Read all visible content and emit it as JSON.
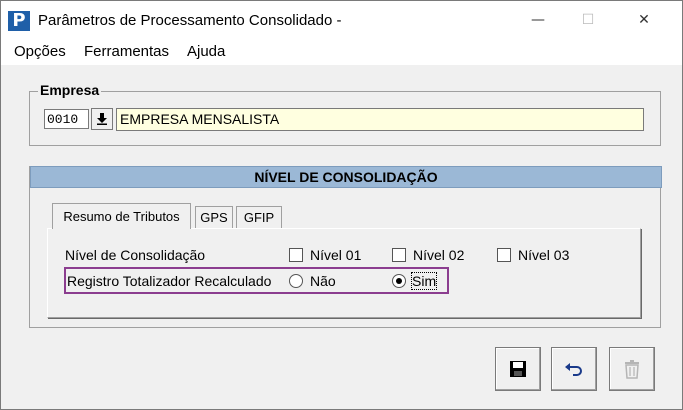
{
  "window": {
    "title": "Parâmetros de Processamento Consolidado -",
    "icon_letter": "P",
    "controls": {
      "minimize": "—",
      "maximize": "☐",
      "close": "✕"
    }
  },
  "menu": {
    "items": [
      "Opções",
      "Ferramentas",
      "Ajuda"
    ]
  },
  "empresa": {
    "legend": "Empresa",
    "code": "0010",
    "lookup_icon": "download-arrow-icon",
    "name": "EMPRESA MENSALISTA"
  },
  "nivel_section": {
    "header": "NÍVEL DE CONSOLIDAÇÃO"
  },
  "tabs": [
    {
      "label": "Resumo de Tributos",
      "active": true
    },
    {
      "label": "GPS",
      "active": false
    },
    {
      "label": "GFIP",
      "active": false
    }
  ],
  "form": {
    "nivel_label": "Nível de Consolidação",
    "checkboxes": [
      {
        "label": "Nível 01",
        "checked": false
      },
      {
        "label": "Nível 02",
        "checked": false
      },
      {
        "label": "Nível 03",
        "checked": false
      }
    ],
    "registro_label": "Registro Totalizador Recalculado",
    "radios": [
      {
        "label": "Não",
        "selected": false
      },
      {
        "label": "Sim",
        "selected": true
      }
    ]
  },
  "actions": [
    {
      "name": "save-button",
      "icon": "floppy-disk-icon"
    },
    {
      "name": "undo-button",
      "icon": "undo-icon"
    },
    {
      "name": "delete-button",
      "icon": "trash-icon",
      "disabled": true
    }
  ],
  "colors": {
    "accent_band": "#9bb8d6",
    "highlight_border": "#8b3d8f",
    "input_yellow": "#ffffe0"
  }
}
